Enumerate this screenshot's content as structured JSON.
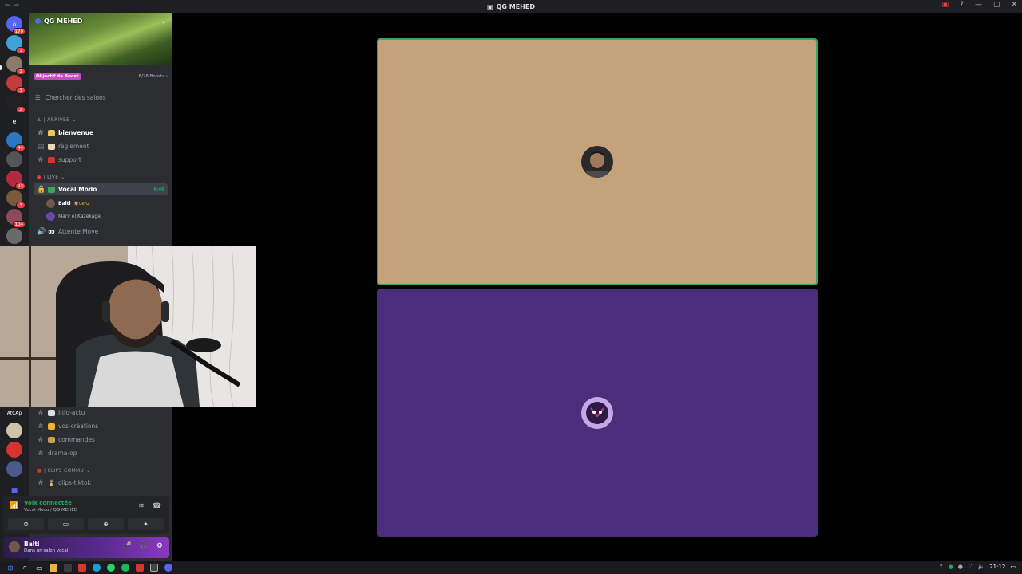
{
  "window": {
    "title": "QG MEHED",
    "nav_arrows": "←  →"
  },
  "server_rail": {
    "items": [
      {
        "icon": "discord-home-icon",
        "badge": "170",
        "color": "#5865f2"
      },
      {
        "icon": "server-icon",
        "badge": "1",
        "color": "#3fa2d8"
      },
      {
        "icon": "server-icon",
        "badge": "1",
        "color": "#8a7a6a"
      },
      {
        "icon": "server-icon",
        "badge": "3",
        "color": "#c23b3b"
      },
      {
        "icon": "server-icon",
        "badge": "2",
        "color": "#222222"
      },
      {
        "icon": "server-letter-icon",
        "text": "e",
        "color": "#1e1f22"
      },
      {
        "icon": "server-icon",
        "badge": "44",
        "color": "#2a78c2"
      },
      {
        "icon": "server-icon",
        "badge": "",
        "color": "#555555"
      },
      {
        "icon": "server-icon",
        "badge": "93",
        "color": "#b02a40"
      },
      {
        "icon": "server-icon",
        "badge": "3",
        "color": "#7a5a3a"
      },
      {
        "icon": "server-icon",
        "badge": "104",
        "color": "#8c4a5a"
      },
      {
        "icon": "server-icon",
        "badge": "",
        "color": "#6a6a6a"
      },
      {
        "icon": "server-letter-icon",
        "text": "AtCAp",
        "color": "#1e1f22"
      },
      {
        "icon": "server-icon",
        "badge": "",
        "color": "#cfc3a8"
      },
      {
        "icon": "server-icon",
        "badge": "",
        "color": "#d8342f"
      },
      {
        "icon": "server-icon",
        "badge": "",
        "color": "#4a5a8a"
      },
      {
        "icon": "folder-icon",
        "badge": "",
        "color": "#5865f2"
      }
    ]
  },
  "sidebar": {
    "server_name": "QG MEHED",
    "boost_label": "Objectif de Boost",
    "boost_count": "6/28 Boosts",
    "search_placeholder": "Chercher des salons",
    "categories": [
      {
        "label": "| ARRIVÉE"
      },
      {
        "label": "| LIVE"
      },
      {
        "label": "| CLIPS COMMU"
      }
    ],
    "channels_arrivee": [
      {
        "label": "bienvenue",
        "emoji_color": "#f2c94c"
      },
      {
        "label": "règlement",
        "emoji_color": "#e9d8b4"
      },
      {
        "label": "support",
        "emoji_color": "#d9342f"
      }
    ],
    "voice_channel": {
      "label": "Vocal Modo",
      "time": "6:46"
    },
    "voice_users": [
      {
        "name": "Balti",
        "tag": "🦁GenZ"
      },
      {
        "name": "Marv el Kazekage",
        "tag": ""
      }
    ],
    "attente": {
      "label": "Attente Move"
    },
    "channels_lower": [
      {
        "label": "info-actu"
      },
      {
        "label": "vos-créations"
      },
      {
        "label": "commandes"
      },
      {
        "label": "drama-op"
      }
    ],
    "clips": [
      {
        "label": "clips-tiktok"
      }
    ]
  },
  "voice_panel": {
    "status": "Voix connectée",
    "location": "Vocal Modo / QG MEHED"
  },
  "user_panel": {
    "name": "Balti",
    "status": "Dans un salon vocal"
  },
  "taskbar": {
    "time": "21:12"
  }
}
